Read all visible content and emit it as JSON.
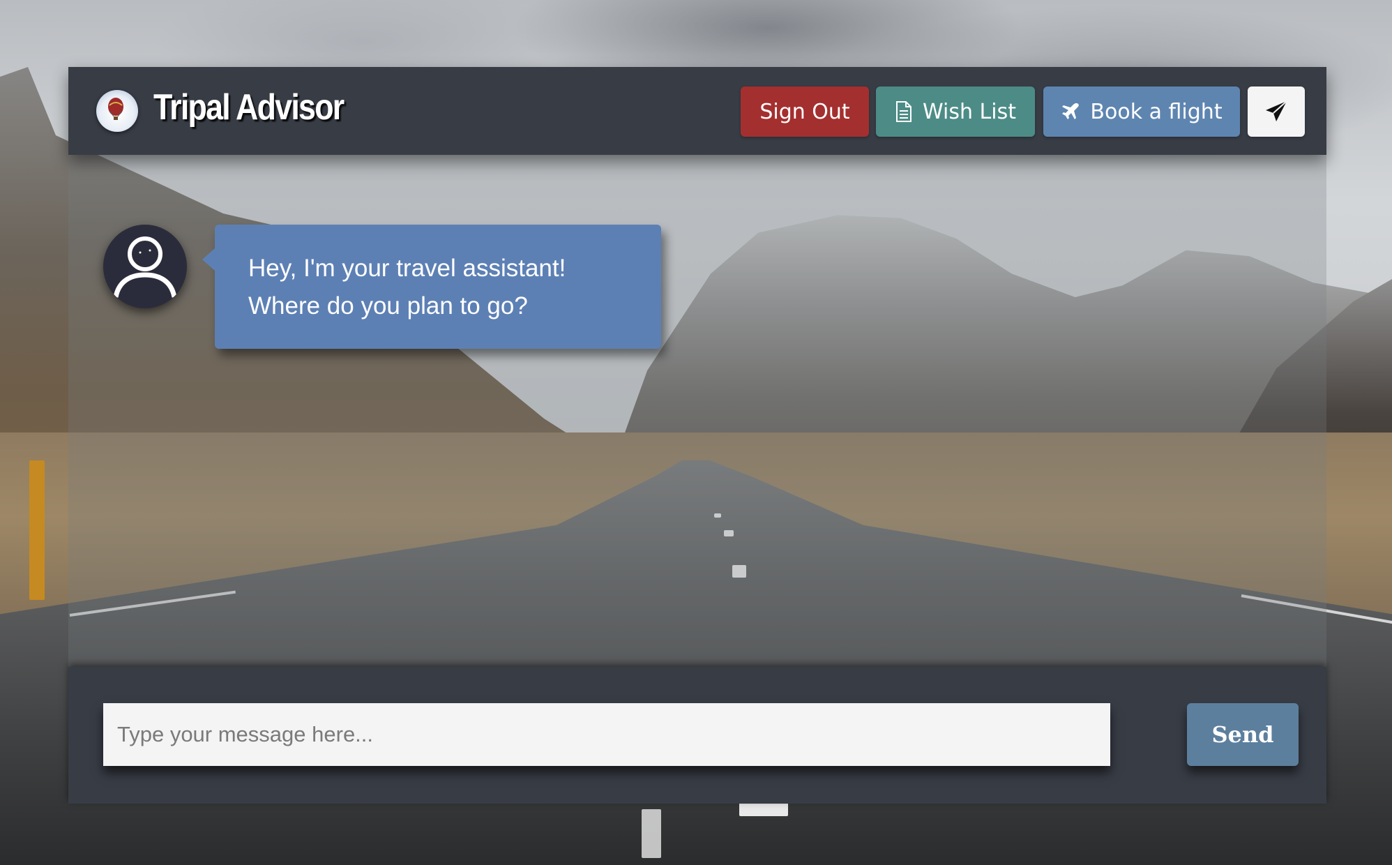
{
  "header": {
    "brand_name": "Tripal Advisor",
    "logo_icon": "hot-air-balloon-logo",
    "buttons": {
      "sign_out": "Sign Out",
      "wish_list": "Wish List",
      "book_flight": "Book a flight",
      "send_icon": "paper-plane-icon"
    }
  },
  "chat": {
    "messages": [
      {
        "sender": "assistant",
        "avatar_icon": "user-avatar-icon",
        "lines": [
          "Hey, I'm your travel assistant!",
          "Where do you plan to go?"
        ]
      }
    ]
  },
  "composer": {
    "placeholder": "Type your message here...",
    "value": "",
    "send_label": "Send"
  },
  "colors": {
    "panel": "#383c45",
    "sign_out": "#a42f2f",
    "wish_list": "#4d8c86",
    "book_flight": "#5e85b0",
    "bubble": "#5d80b4",
    "send": "#5d7f9e"
  }
}
